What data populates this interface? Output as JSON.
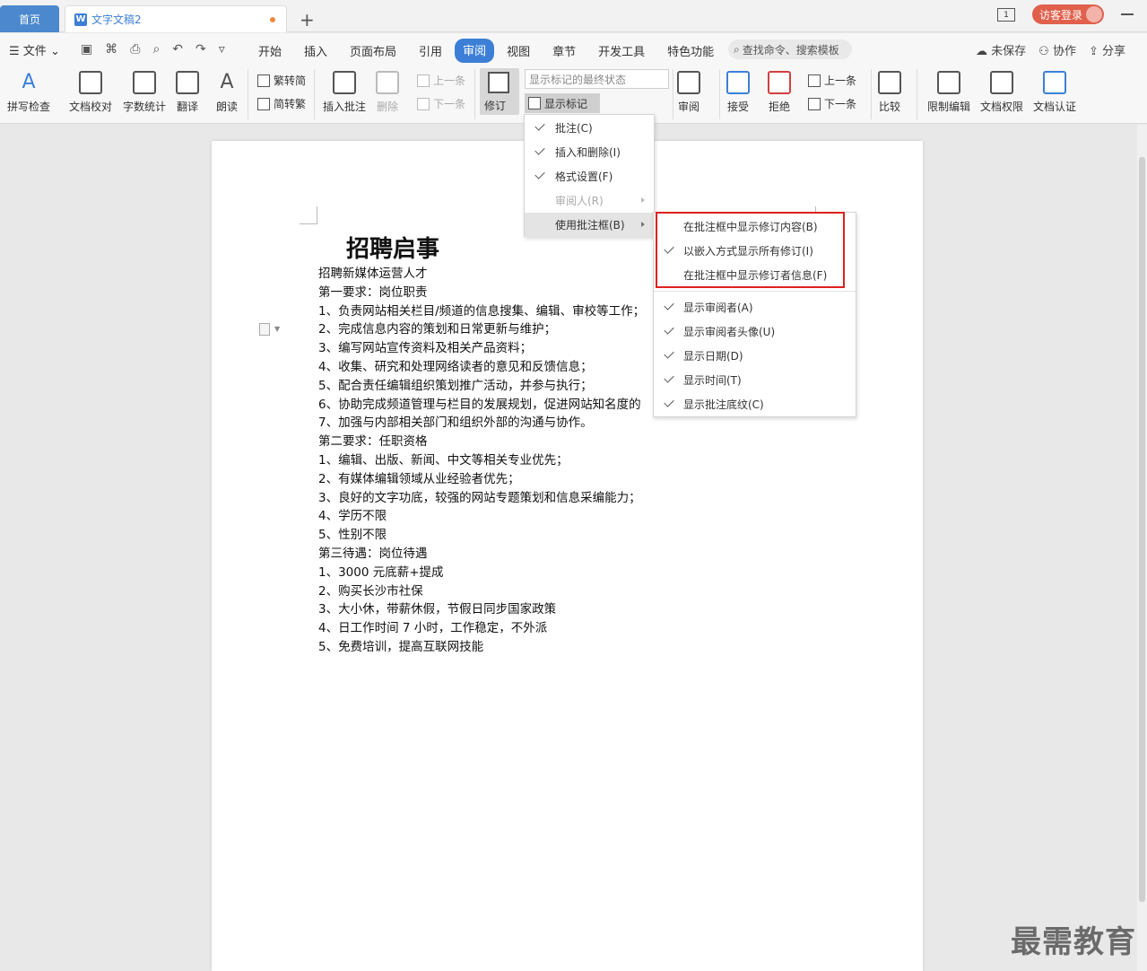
{
  "titlebar": {
    "home_tab": "首页",
    "doc_tab": "文字文稿2",
    "new_tab": "+",
    "page_indicator": "1",
    "login_label": "访客登录"
  },
  "menubar": {
    "file_label": "文件",
    "tabs": [
      "开始",
      "插入",
      "页面布局",
      "引用",
      "审阅",
      "视图",
      "章节",
      "开发工具",
      "特色功能"
    ],
    "active_tab": "审阅",
    "search_placeholder": "查找命令、搜索模板",
    "unsaved": "未保存",
    "collab": "协作",
    "share": "分享"
  },
  "ribbon": {
    "spell_check": "拼写检查",
    "proofread": "文档校对",
    "word_count": "字数统计",
    "translate": "翻译",
    "read_aloud": "朗读",
    "trad_to_simp": "繁转简",
    "simp_to_trad": "简转繁",
    "insert_comment": "插入批注",
    "delete": "删除",
    "prev_comment": "上一条",
    "next_comment": "下一条",
    "track_changes": "修订",
    "markup_state": "显示标记的最终状态",
    "show_markup": "显示标记",
    "review": "审阅",
    "accept": "接受",
    "reject": "拒绝",
    "prev_change": "上一条",
    "next_change": "下一条",
    "compare": "比较",
    "restrict_edit": "限制编辑",
    "doc_permission": "文档权限",
    "doc_certify": "文档认证"
  },
  "document": {
    "title": "招聘启事",
    "lines": [
      "招聘新媒体运营人才",
      "第一要求：岗位职责",
      "1、负责网站相关栏目/频道的信息搜集、编辑、审校等工作；",
      "2、完成信息内容的策划和日常更新与维护；",
      "3、编写网站宣传资料及相关产品资料；",
      "4、收集、研究和处理网络读者的意见和反馈信息；",
      "5、配合责任编辑组织策划推广活动，并参与执行；",
      "6、协助完成频道管理与栏目的发展规划，促进网站知名度的",
      "7、加强与内部相关部门和组织外部的沟通与协作。",
      "第二要求：任职资格",
      "1、编辑、出版、新闻、中文等相关专业优先；",
      "2、有媒体编辑领域从业经验者优先；",
      "3、良好的文字功底，较强的网站专题策划和信息采编能力；",
      "4、学历不限",
      "5、性别不限",
      "第三待遇：岗位待遇",
      "1、3000 元底薪+提成",
      "2、购买长沙市社保",
      "3、大小休，带薪休假，节假日同步国家政策",
      "4、日工作时间 7 小时，工作稳定，不外派",
      "5、免费培训，提高互联网技能"
    ]
  },
  "dropdown": {
    "items": [
      {
        "label": "批注(C)",
        "checked": true,
        "disabled": false,
        "submenu": false
      },
      {
        "label": "插入和删除(I)",
        "checked": true,
        "disabled": false,
        "submenu": false
      },
      {
        "label": "格式设置(F)",
        "checked": true,
        "disabled": false,
        "submenu": false
      },
      {
        "label": "审阅人(R)",
        "checked": false,
        "disabled": true,
        "submenu": true
      },
      {
        "label": "使用批注框(B)",
        "checked": false,
        "disabled": false,
        "submenu": true
      }
    ]
  },
  "submenu": {
    "items": [
      {
        "label": "在批注框中显示修订内容(B)",
        "checked": false
      },
      {
        "label": "以嵌入方式显示所有修订(I)",
        "checked": true
      },
      {
        "label": "在批注框中显示修订者信息(F)",
        "checked": false
      },
      {
        "label": "显示审阅者(A)",
        "checked": true
      },
      {
        "label": "显示审阅者头像(U)",
        "checked": true
      },
      {
        "label": "显示日期(D)",
        "checked": true
      },
      {
        "label": "显示时间(T)",
        "checked": true
      },
      {
        "label": "显示批注底纹(C)",
        "checked": true
      }
    ]
  },
  "watermark": "最需教育",
  "colors": {
    "accent": "#3d7fd6",
    "highlight_box": "#e02020",
    "login": "#e0604c"
  }
}
